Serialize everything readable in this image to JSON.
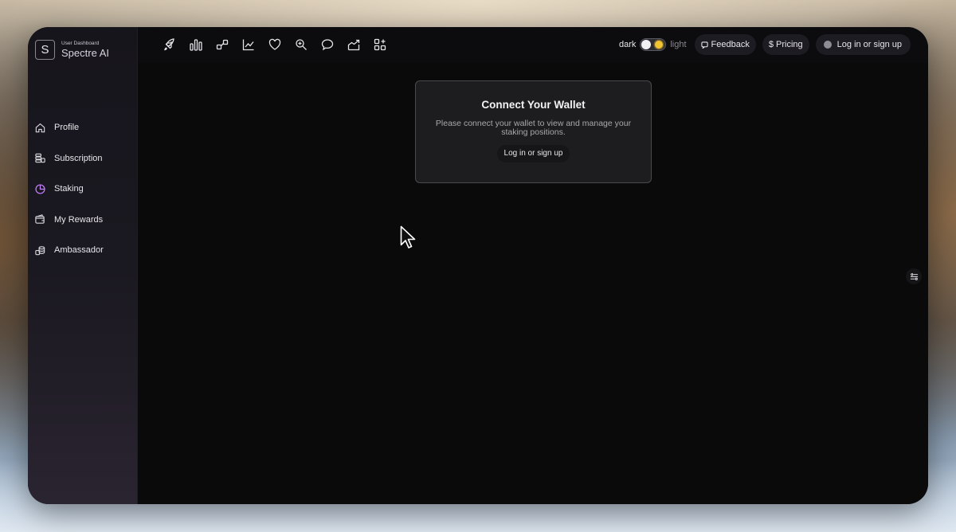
{
  "brand": {
    "subtitle": "User Dashboard",
    "name": "Spectre AI",
    "logo_letter": "S"
  },
  "sidebar": {
    "items": [
      {
        "label": "Profile",
        "icon": "home-icon"
      },
      {
        "label": "Subscription",
        "icon": "coins-icon"
      },
      {
        "label": "Staking",
        "icon": "pie-chart-icon",
        "active": true
      },
      {
        "label": "My Rewards",
        "icon": "wallet-icon"
      },
      {
        "label": "Ambassador",
        "icon": "coin-stack-icon"
      }
    ]
  },
  "toolbar": {
    "icons": [
      "rocket-icon",
      "bar-chart-icon",
      "nodes-icon",
      "line-chart-icon",
      "heart-icon",
      "magnify-icon",
      "chat-icon",
      "growth-icon",
      "apps-icon"
    ],
    "theme": {
      "dark_label": "dark",
      "light_label": "light",
      "current": "dark"
    },
    "feedback_label": "Feedback",
    "pricing_label": "$ Pricing",
    "login_label": "Log in or sign up"
  },
  "card": {
    "title": "Connect Your Wallet",
    "description": "Please connect your wallet to view and manage your staking positions.",
    "button_label": "Log in or sign up"
  },
  "colors": {
    "accent": "#c77dff",
    "background": "#0a0a0b",
    "card": "#1d1d1f"
  }
}
